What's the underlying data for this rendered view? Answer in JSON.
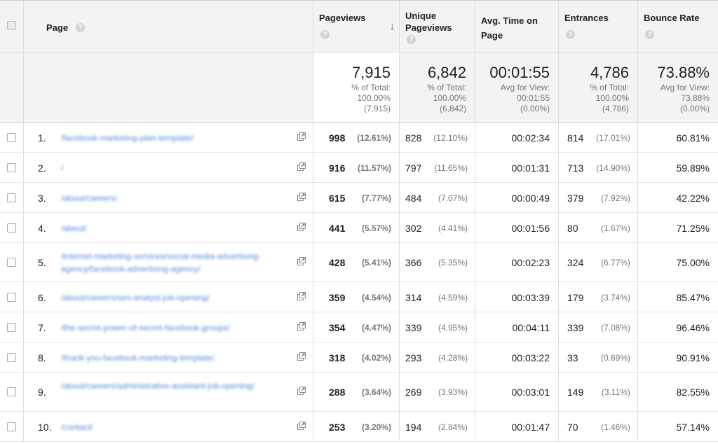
{
  "headers": {
    "page": "Page",
    "pageviews": "Pageviews",
    "unique_pageviews_1": "Unique",
    "unique_pageviews_2": "Pageviews",
    "avg_time_1": "Avg. Time on",
    "avg_time_2": "Page",
    "entrances": "Entrances",
    "bounce_rate": "Bounce Rate",
    "help_glyph": "?",
    "sort_glyph": "↓"
  },
  "summary": {
    "pageviews": {
      "value": "7,915",
      "l1": "% of Total:",
      "l2": "100.00%",
      "l3": "(7,915)"
    },
    "unique_pageviews": {
      "value": "6,842",
      "l1": "% of Total:",
      "l2": "100.00%",
      "l3": "(6,842)"
    },
    "avg_time": {
      "value": "00:01:55",
      "l1": "Avg for View:",
      "l2": "00:01:55",
      "l3": "(0.00%)"
    },
    "entrances": {
      "value": "4,786",
      "l1": "% of Total:",
      "l2": "100.00%",
      "l3": "(4,786)"
    },
    "bounce_rate": {
      "value": "73.88%",
      "l1": "Avg for View:",
      "l2": "73.88%",
      "l3": "(0.00%)"
    }
  },
  "rows": [
    {
      "n": "1.",
      "page": "/facebook-marketing-plan-template/",
      "pv": "998",
      "pvp": "(12.61%)",
      "up": "828",
      "upp": "(12.10%)",
      "at": "00:02:34",
      "en": "814",
      "enp": "(17.01%)",
      "br": "60.81%"
    },
    {
      "n": "2.",
      "page": "/",
      "pv": "916",
      "pvp": "(11.57%)",
      "up": "797",
      "upp": "(11.65%)",
      "at": "00:01:31",
      "en": "713",
      "enp": "(14.90%)",
      "br": "59.89%"
    },
    {
      "n": "3.",
      "page": "/about/careers/",
      "pv": "615",
      "pvp": "(7.77%)",
      "up": "484",
      "upp": "(7.07%)",
      "at": "00:00:49",
      "en": "379",
      "enp": "(7.92%)",
      "br": "42.22%"
    },
    {
      "n": "4.",
      "page": "/about/",
      "pv": "441",
      "pvp": "(5.57%)",
      "up": "302",
      "upp": "(4.41%)",
      "at": "00:01:56",
      "en": "80",
      "enp": "(1.67%)",
      "br": "71.25%"
    },
    {
      "n": "5.",
      "page": "/internet-marketing-services/social-media-advertising-agency/facebook-advertising-agency/",
      "pv": "428",
      "pvp": "(5.41%)",
      "up": "366",
      "upp": "(5.35%)",
      "at": "00:02:23",
      "en": "324",
      "enp": "(6.77%)",
      "br": "75.00%"
    },
    {
      "n": "6.",
      "page": "/about/careers/seo-analyst-job-opening/",
      "pv": "359",
      "pvp": "(4.54%)",
      "up": "314",
      "upp": "(4.59%)",
      "at": "00:03:39",
      "en": "179",
      "enp": "(3.74%)",
      "br": "85.47%"
    },
    {
      "n": "7.",
      "page": "/the-secret-power-of-secret-facebook-groups/",
      "pv": "354",
      "pvp": "(4.47%)",
      "up": "339",
      "upp": "(4.95%)",
      "at": "00:04:11",
      "en": "339",
      "enp": "(7.08%)",
      "br": "96.46%"
    },
    {
      "n": "8.",
      "page": "/thank-you-facebook-marketing-template/",
      "pv": "318",
      "pvp": "(4.02%)",
      "up": "293",
      "upp": "(4.28%)",
      "at": "00:03:22",
      "en": "33",
      "enp": "(0.69%)",
      "br": "90.91%"
    },
    {
      "n": "9.",
      "page": "/about/careers/administrative-assistant-job-opening/",
      "pv": "288",
      "pvp": "(3.64%)",
      "up": "269",
      "upp": "(3.93%)",
      "at": "00:03:01",
      "en": "149",
      "enp": "(3.11%)",
      "br": "82.55%"
    },
    {
      "n": "10.",
      "page": "/contact/",
      "pv": "253",
      "pvp": "(3.20%)",
      "up": "194",
      "upp": "(2.84%)",
      "at": "00:01:47",
      "en": "70",
      "enp": "(1.46%)",
      "br": "57.14%"
    }
  ]
}
